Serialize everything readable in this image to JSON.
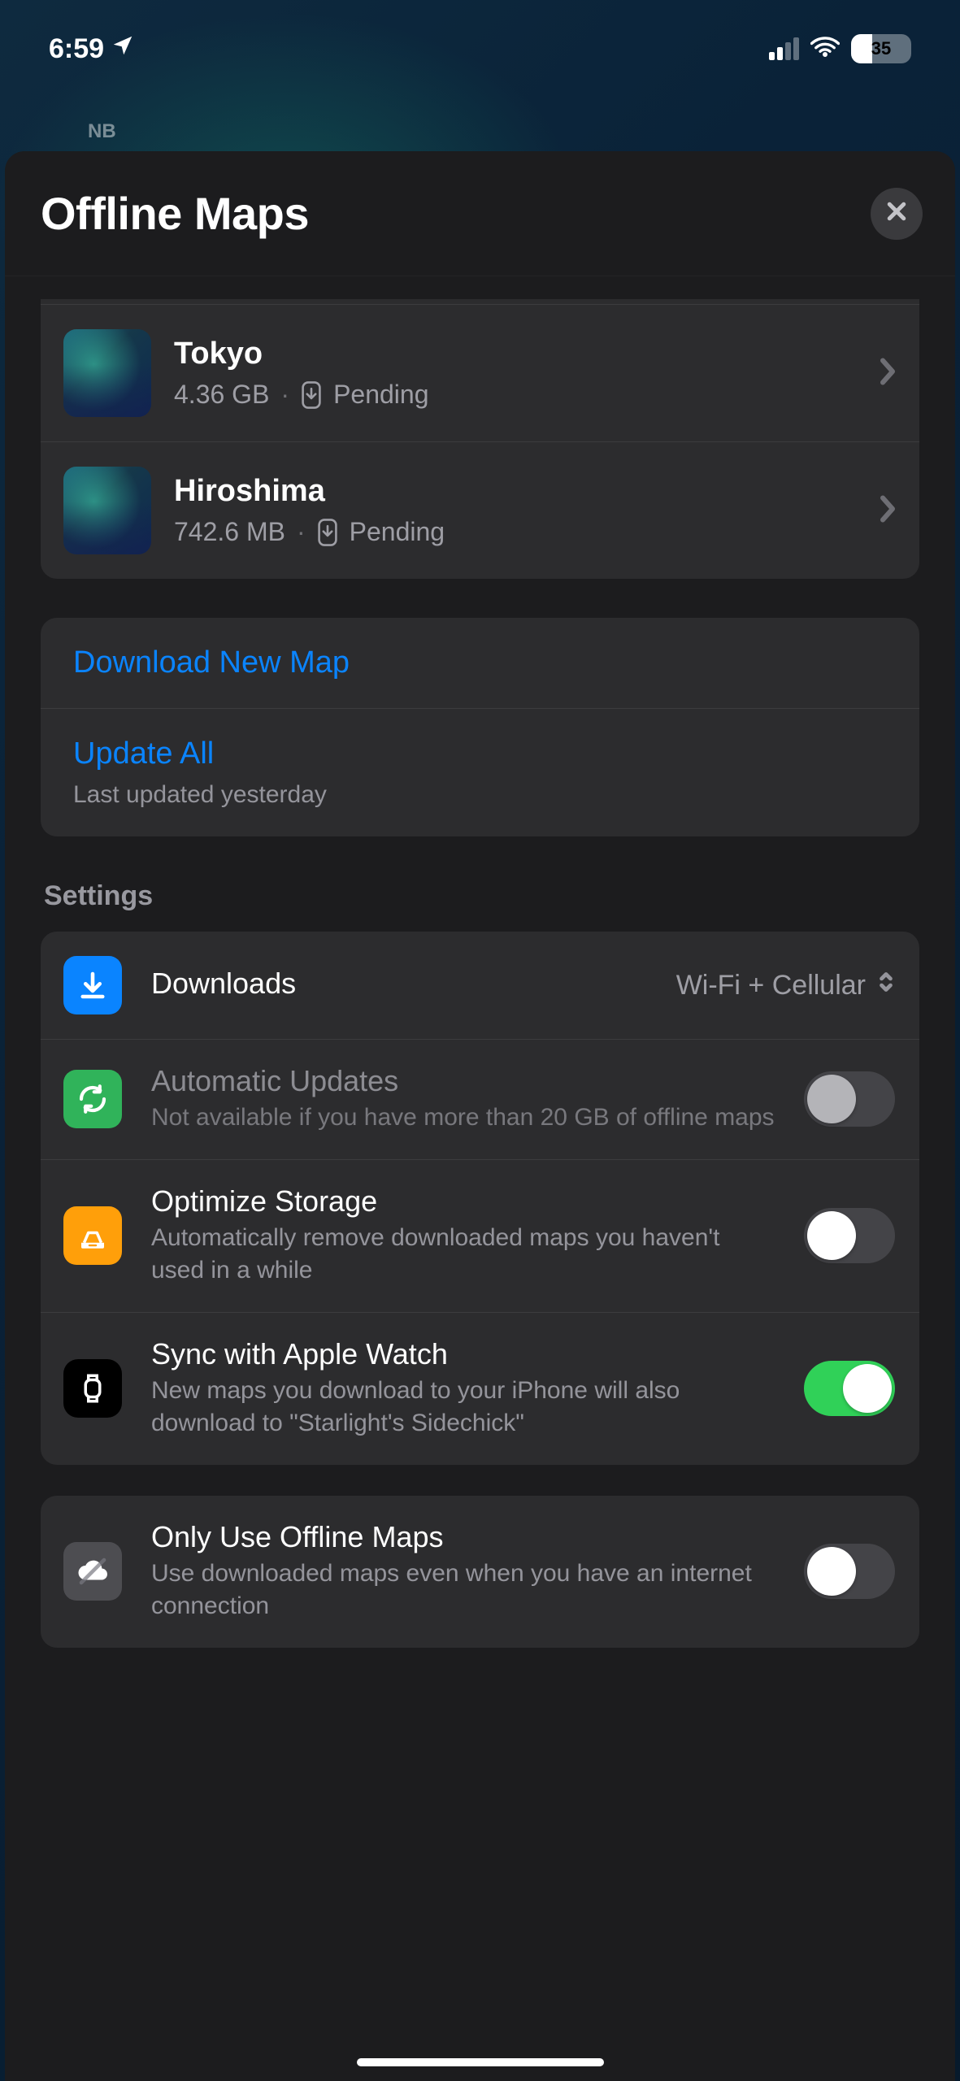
{
  "status": {
    "time": "6:59",
    "battery_percent": "35"
  },
  "mapOverlay": {
    "label": "NB"
  },
  "sheet": {
    "title": "Offline Maps"
  },
  "maps": [
    {
      "name": "Tokyo",
      "size": "4.36 GB",
      "status": "Pending"
    },
    {
      "name": "Hiroshima",
      "size": "742.6 MB",
      "status": "Pending"
    }
  ],
  "actions": {
    "download": "Download New Map",
    "updateAll": "Update All",
    "updateAllSub": "Last updated yesterday"
  },
  "sections": {
    "settings": "Settings"
  },
  "settings": {
    "downloads": {
      "title": "Downloads",
      "value": "Wi-Fi + Cellular"
    },
    "autoUpdates": {
      "title": "Automatic Updates",
      "sub": "Not available if you have more than 20 GB of offline maps",
      "on": false,
      "disabled": true
    },
    "optimize": {
      "title": "Optimize Storage",
      "sub": "Automatically remove downloaded maps you haven't used in a while",
      "on": false
    },
    "sync": {
      "title": "Sync with Apple Watch",
      "sub": "New maps you download to your iPhone will also download to \"Starlight's Sidechick\"",
      "on": true
    },
    "onlyOffline": {
      "title": "Only Use Offline Maps",
      "sub": "Use downloaded maps even when you have an internet connection",
      "on": false
    }
  }
}
